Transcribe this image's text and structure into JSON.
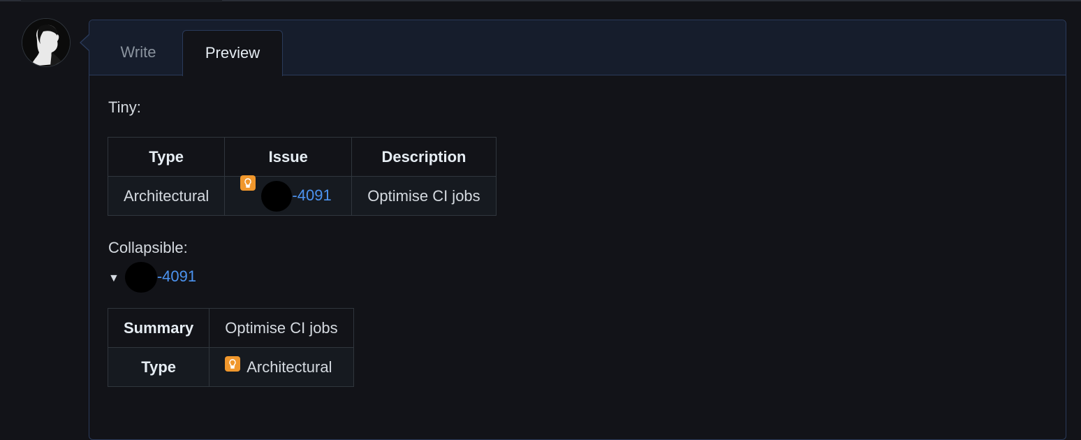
{
  "editor": {
    "tabs": [
      {
        "label": "Write",
        "active": false
      },
      {
        "label": "Preview",
        "active": true
      }
    ]
  },
  "preview": {
    "tiny_label": "Tiny:",
    "tiny_table": {
      "headers": [
        "Type",
        "Issue",
        "Description"
      ],
      "rows": [
        {
          "type": "Architectural",
          "issue_suffix": "-4091",
          "description": "Optimise CI jobs",
          "issue_icon": "lightbulb-icon"
        }
      ]
    },
    "collapsible_label": "Collapsible:",
    "collapsible_summary_suffix": "-4091",
    "details_table": {
      "rows": [
        {
          "key": "Summary",
          "value": "Optimise CI jobs"
        },
        {
          "key": "Type",
          "value": "Architectural",
          "icon": "lightbulb-icon"
        }
      ]
    }
  },
  "colors": {
    "background": "#121318",
    "link": "#4c93f0",
    "icon_orange": "#f0972c",
    "border": "#30363d"
  }
}
